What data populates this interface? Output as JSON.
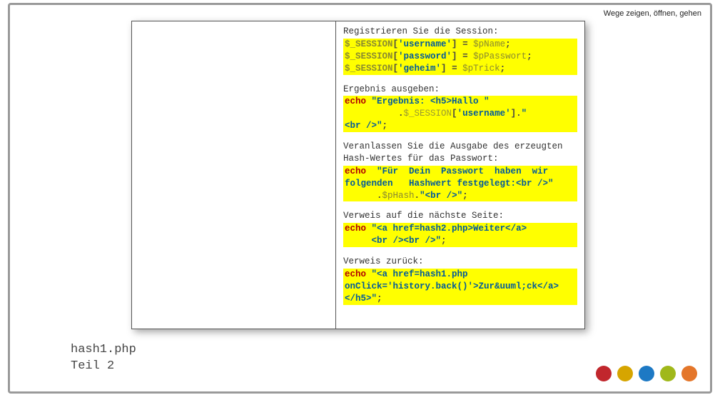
{
  "tagline": "Wege zeigen, öffnen, gehen",
  "footer": {
    "line1": "hash1.php",
    "line2": "Teil 2"
  },
  "blocks": [
    {
      "title": "Registrieren Sie die Session:",
      "code_html": "<span class='c-sess'>$_SESSION</span><span class='c-punc'>[</span><span class='c-key'>'username'</span><span class='c-punc'>]</span> <span class='c-punc'>=</span> <span class='c-var'>$pName</span><span class='c-punc'>;</span>\n<span class='c-sess'>$_SESSION</span><span class='c-punc'>[</span><span class='c-key'>'password'</span><span class='c-punc'>]</span> <span class='c-punc'>=</span> <span class='c-var'>$pPasswort</span><span class='c-punc'>;</span>\n<span class='c-sess'>$_SESSION</span><span class='c-punc'>[</span><span class='c-key'>'geheim'</span><span class='c-punc'>]</span> <span class='c-punc'>=</span> <span class='c-var'>$pTrick</span><span class='c-punc'>;</span>"
    },
    {
      "title": "Ergebnis ausgeben:",
      "code_html": "<span class='c-echo'>echo</span> <span class='c-str'>\"Ergebnis: &lt;h5&gt;Hallo \"</span>\n          <span class='c-punc'>.</span><span class='c-pale'>$_SESSION</span><span class='c-punc'>[</span><span class='c-key'>'username'</span><span class='c-punc'>].</span><span class='c-str'>\"</span>\n<span class='c-str'>&lt;br /&gt;\"</span><span class='c-punc'>;</span>"
    },
    {
      "title": "Veranlassen Sie die Ausgabe des erzeugten Hash-Wertes für das Passwort:",
      "code_html": "<span class='c-echo'>echo</span>  <span class='c-str'>\"Für  Dein  Passwort  haben  wir folgenden   Hashwert festgelegt:&lt;br /&gt;\"</span>\n      <span class='c-punc'>.</span><span class='c-var'>$pHash</span><span class='c-punc'>.</span><span class='c-str'>\"&lt;br /&gt;\"</span><span class='c-punc'>;</span>"
    },
    {
      "title": "Verweis auf die nächste Seite:",
      "code_html": "<span class='c-echo'>echo</span> <span class='c-str'>\"&lt;a href=hash2.php&gt;Weiter&lt;/a&gt;</span>\n     <span class='c-str'>&lt;br /&gt;&lt;br /&gt;\"</span><span class='c-punc'>;</span>"
    },
    {
      "title": "Verweis zurück:",
      "code_html": "<span class='c-echo'>echo</span> <span class='c-str'>\"&lt;a href=hash1.php </span>\n<span class='c-str'>onClick='history.back()'&gt;Zur&amp;uuml;ck&lt;/a&gt;&lt;/h5&gt;\"</span><span class='c-punc'>;</span>"
    }
  ],
  "dots": [
    {
      "name": "dot-red",
      "color": "#c1272d"
    },
    {
      "name": "dot-yellow",
      "color": "#d6a500"
    },
    {
      "name": "dot-blue",
      "color": "#1d79c4"
    },
    {
      "name": "dot-green",
      "color": "#a0b81a"
    },
    {
      "name": "dot-orange",
      "color": "#e4762a"
    }
  ]
}
